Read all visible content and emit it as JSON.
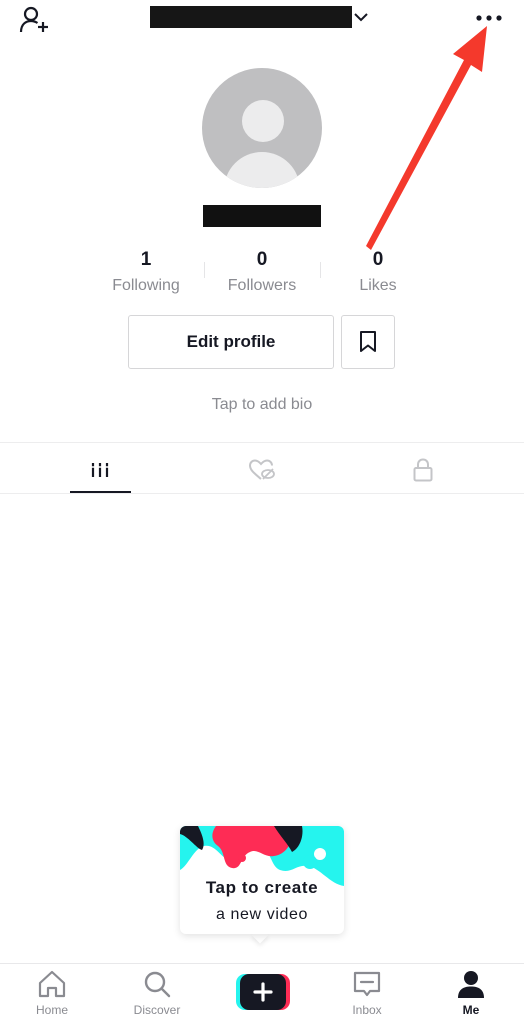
{
  "header": {
    "add_friends_icon": "add-user-icon",
    "account_switch_icon": "chevron-down-icon",
    "more_icon": "more-horizontal-icon"
  },
  "profile": {
    "stats": [
      {
        "value": "1",
        "label": "Following"
      },
      {
        "value": "0",
        "label": "Followers"
      },
      {
        "value": "0",
        "label": "Likes"
      }
    ],
    "edit_profile_label": "Edit profile",
    "bookmark_icon": "bookmark-icon",
    "bio_placeholder": "Tap to add bio"
  },
  "tabs": [
    {
      "icon": "videos-grid-icon",
      "active": true
    },
    {
      "icon": "liked-hidden-icon",
      "active": false
    },
    {
      "icon": "lock-icon",
      "active": false
    }
  ],
  "create_prompt": {
    "title": "Tap to create",
    "subtitle": "a new video"
  },
  "bottom_nav": [
    {
      "label": "Home",
      "icon": "home-icon",
      "active": false
    },
    {
      "label": "Discover",
      "icon": "search-icon",
      "active": false
    },
    {
      "label": "",
      "icon": "plus-icon",
      "active": false
    },
    {
      "label": "Inbox",
      "icon": "inbox-icon",
      "active": false
    },
    {
      "label": "Me",
      "icon": "profile-icon",
      "active": true
    }
  ],
  "colors": {
    "text_primary": "#161823",
    "text_secondary": "#8a8b91",
    "brand_cyan": "#25f4ee",
    "brand_pink": "#fe2c55",
    "annotation_arrow": "#f4392c"
  }
}
